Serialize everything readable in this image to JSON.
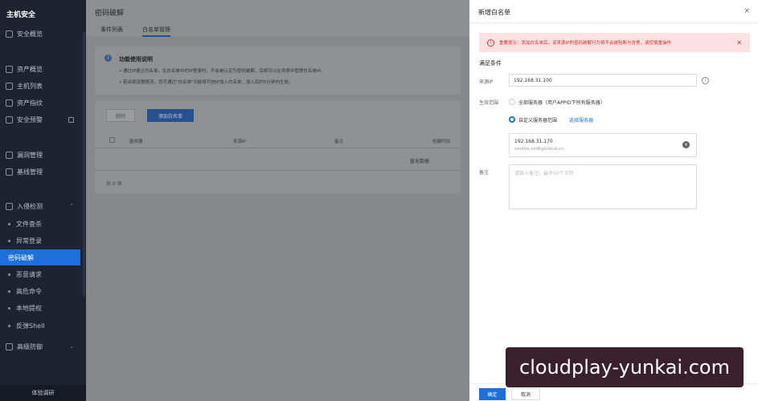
{
  "sidebar": {
    "title": "主机安全",
    "items": [
      {
        "label": "安全概览",
        "icon": "dashboard-icon"
      },
      {
        "label": "资产概览",
        "icon": "asset-icon"
      },
      {
        "label": "主机列表",
        "icon": "host-icon"
      },
      {
        "label": "资产指纹",
        "icon": "fingerprint-icon"
      },
      {
        "label": "安全预警",
        "icon": "alert-icon"
      },
      {
        "label": "漏洞管理",
        "icon": "bug-icon"
      },
      {
        "label": "基线管理",
        "icon": "baseline-icon"
      },
      {
        "label": "入侵检测",
        "icon": "intrusion-icon"
      }
    ],
    "sub_items": [
      "文件查杀",
      "异常登录",
      "密码破解",
      "恶意请求",
      "高危命令",
      "本地提权",
      "反弹Shell"
    ],
    "after_items": [
      {
        "label": "高级防御",
        "icon": "shield-icon"
      }
    ],
    "footer": "体验调研"
  },
  "main": {
    "title": "密码破解",
    "tabs": [
      "事件列表",
      "白名单管理"
    ],
    "info": {
      "title": "功能使用说明",
      "lines": [
        "• 通过IP建立白名单，在白名单中的IP登录时，不会被认定为密码破解，后续可以在列表中管理白名单IP。",
        "• 若出现误报情况，您可通过\"白名单\"功能将可信IP加入白名单，加入后约5分钟内生效。"
      ]
    },
    "buttons": {
      "delete": "删除",
      "add": "添加白名单"
    },
    "columns": [
      "服务器",
      "来源IP",
      "备注",
      "创建时间"
    ],
    "empty": "暂无数据",
    "total": "共 0 项"
  },
  "drawer": {
    "title": "新增白名单",
    "close": "×",
    "alert": "重要提示：添加白名单后，该来源IP的密码破解行为将不会被阻断与告警，请您慎重操作",
    "section": "满足条件",
    "labels": {
      "source_ip": "来源IP",
      "scope": "生效范围",
      "remark": "备注"
    },
    "source_ip": "192.168.31.100",
    "scope_options": {
      "all": "全部服务器（用户APPID下所有服务器）",
      "custom": "自定义服务器范围",
      "select_link": "选择服务器"
    },
    "server": {
      "ip": "192.168.31.170",
      "host": "centos.xxdkglcloud.cn"
    },
    "remark_placeholder": "请输入备注，最多50个字符",
    "buttons": {
      "ok": "确定",
      "cancel": "取消"
    }
  },
  "watermark": "cloudplay-yunkai.com"
}
